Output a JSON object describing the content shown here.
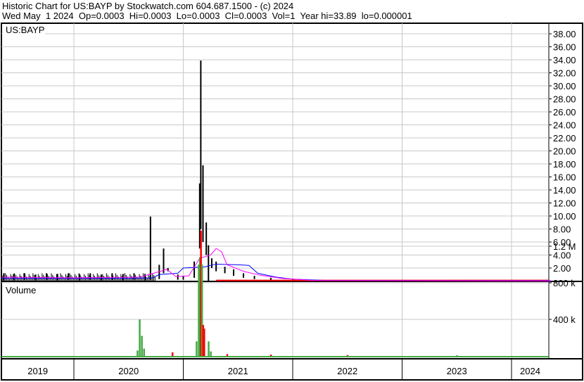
{
  "header": {
    "title": "Historic Chart for US:BAYP by Stockwatch.com 604.687.1500 - (c) 2024",
    "quote": "Wed May  1 2024  Op=0.0003  Hi=0.0003  Lo=0.0003  Cl=0.0003  Vol=1  Year hi=33.89  lo=0.000001"
  },
  "chart_data": {
    "type": "bar",
    "symbol": "US:BAYP",
    "volume_label": "Volume",
    "price_ylim": [
      0,
      39.5
    ],
    "price_ticks": [
      "2.00",
      "4.00",
      "6.00",
      "8.00",
      "10.00",
      "12.00",
      "14.00",
      "16.00",
      "18.00",
      "20.00",
      "22.00",
      "24.00",
      "26.00",
      "28.00",
      "30.00",
      "32.00",
      "34.00",
      "36.00",
      "38.00"
    ],
    "volume_ylim": [
      0,
      1400000
    ],
    "volume_ticks": [
      {
        "v": 400000,
        "label": "400 k"
      },
      {
        "v": 800000,
        "label": "800 k"
      },
      {
        "v": 1200000,
        "label": "1.2 M"
      }
    ],
    "x_range": [
      2019.34,
      2024.36
    ],
    "year_labels": [
      "2019",
      "2020",
      "2021",
      "2022",
      "2023",
      "2024"
    ],
    "colors": {
      "price": "#000000",
      "down": "#ff0000",
      "up": "#44aa44",
      "ma_short": "#ff00ff",
      "ma_long": "#0000ff",
      "grid": "#c8c8c8"
    },
    "price_bars": [
      [
        2019.36,
        1.2,
        0.1
      ],
      [
        2019.45,
        1.1,
        0.1
      ],
      [
        2019.55,
        1.2,
        0.2
      ],
      [
        2019.65,
        1.0,
        0.1
      ],
      [
        2019.75,
        1.2,
        0.2
      ],
      [
        2019.85,
        1.1,
        0.1
      ],
      [
        2019.95,
        1.2,
        0.2
      ],
      [
        2020.05,
        1.1,
        0.1
      ],
      [
        2020.15,
        1.2,
        0.2
      ],
      [
        2020.25,
        1.0,
        0.1
      ],
      [
        2020.35,
        1.2,
        0.2
      ],
      [
        2020.45,
        1.1,
        0.1
      ],
      [
        2020.55,
        1.2,
        0.2
      ],
      [
        2020.65,
        1.1,
        0.1
      ],
      [
        2020.7,
        9.9,
        0.2
      ],
      [
        2020.78,
        2.5,
        0.3
      ],
      [
        2020.82,
        5.0,
        1.2
      ],
      [
        2020.86,
        2.0,
        1.5
      ],
      [
        2020.95,
        1.0,
        0.2
      ],
      [
        2021.0,
        0.8,
        0.2
      ],
      [
        2021.1,
        3.0,
        0.5
      ],
      [
        2021.15,
        15.0,
        5.0
      ],
      [
        2021.16,
        33.89,
        8.0
      ],
      [
        2021.18,
        17.8,
        6.0
      ],
      [
        2021.21,
        9.0,
        4.0
      ],
      [
        2021.23,
        5.5,
        0.0
      ],
      [
        2021.26,
        3.5,
        2.0
      ],
      [
        2021.3,
        3.0,
        1.5
      ],
      [
        2021.38,
        2.2,
        1.2
      ],
      [
        2021.46,
        1.8,
        0.8
      ],
      [
        2021.55,
        1.2,
        0.5
      ],
      [
        2021.65,
        0.8,
        0.3
      ],
      [
        2021.8,
        0.5,
        0.1
      ],
      [
        2022.0,
        0.3,
        0.05
      ],
      [
        2022.5,
        0.1,
        0.0
      ],
      [
        2023.0,
        0.05,
        0.0
      ],
      [
        2024.0,
        0.01,
        0.0
      ]
    ],
    "ma_short": [
      [
        2019.34,
        0.6
      ],
      [
        2020.0,
        0.5
      ],
      [
        2020.6,
        0.6
      ],
      [
        2020.75,
        1.3
      ],
      [
        2020.85,
        1.8
      ],
      [
        2020.93,
        0.7
      ],
      [
        2021.05,
        0.8
      ],
      [
        2021.15,
        3.5
      ],
      [
        2021.25,
        4.0
      ],
      [
        2021.3,
        5.0
      ],
      [
        2021.35,
        4.5
      ],
      [
        2021.4,
        2.5
      ],
      [
        2021.55,
        1.5
      ],
      [
        2021.7,
        0.9
      ],
      [
        2021.9,
        0.4
      ],
      [
        2022.2,
        0.1
      ],
      [
        2024.36,
        0.0
      ]
    ],
    "ma_long": [
      [
        2019.34,
        0.4
      ],
      [
        2020.5,
        0.4
      ],
      [
        2020.72,
        0.5
      ],
      [
        2020.78,
        1.0
      ],
      [
        2020.95,
        1.2
      ],
      [
        2021.0,
        2.0
      ],
      [
        2021.2,
        2.2
      ],
      [
        2021.3,
        2.6
      ],
      [
        2021.5,
        2.5
      ],
      [
        2021.6,
        2.4
      ],
      [
        2021.68,
        1.2
      ],
      [
        2021.85,
        0.6
      ],
      [
        2022.0,
        0.3
      ],
      [
        2022.3,
        0.1
      ],
      [
        2024.36,
        0.05
      ]
    ],
    "volume_bars": [
      [
        2020.58,
        60000,
        "up"
      ],
      [
        2020.6,
        400000,
        "up"
      ],
      [
        2020.62,
        220000,
        "up"
      ],
      [
        2020.64,
        80000,
        "up"
      ],
      [
        2020.9,
        40000,
        "down"
      ],
      [
        2021.12,
        160000,
        "up"
      ],
      [
        2021.14,
        1000000,
        "up"
      ],
      [
        2021.15,
        1080000,
        "up"
      ],
      [
        2021.16,
        1370000,
        "down"
      ],
      [
        2021.17,
        1000000,
        "up"
      ],
      [
        2021.18,
        340000,
        "down"
      ],
      [
        2021.19,
        300000,
        "down"
      ],
      [
        2021.23,
        160000,
        "up"
      ],
      [
        2021.25,
        50000,
        "up"
      ],
      [
        2021.4,
        20000,
        "down"
      ],
      [
        2021.8,
        15000,
        "down"
      ],
      [
        2022.5,
        10000,
        "down"
      ],
      [
        2023.5,
        8000,
        "up"
      ]
    ]
  }
}
